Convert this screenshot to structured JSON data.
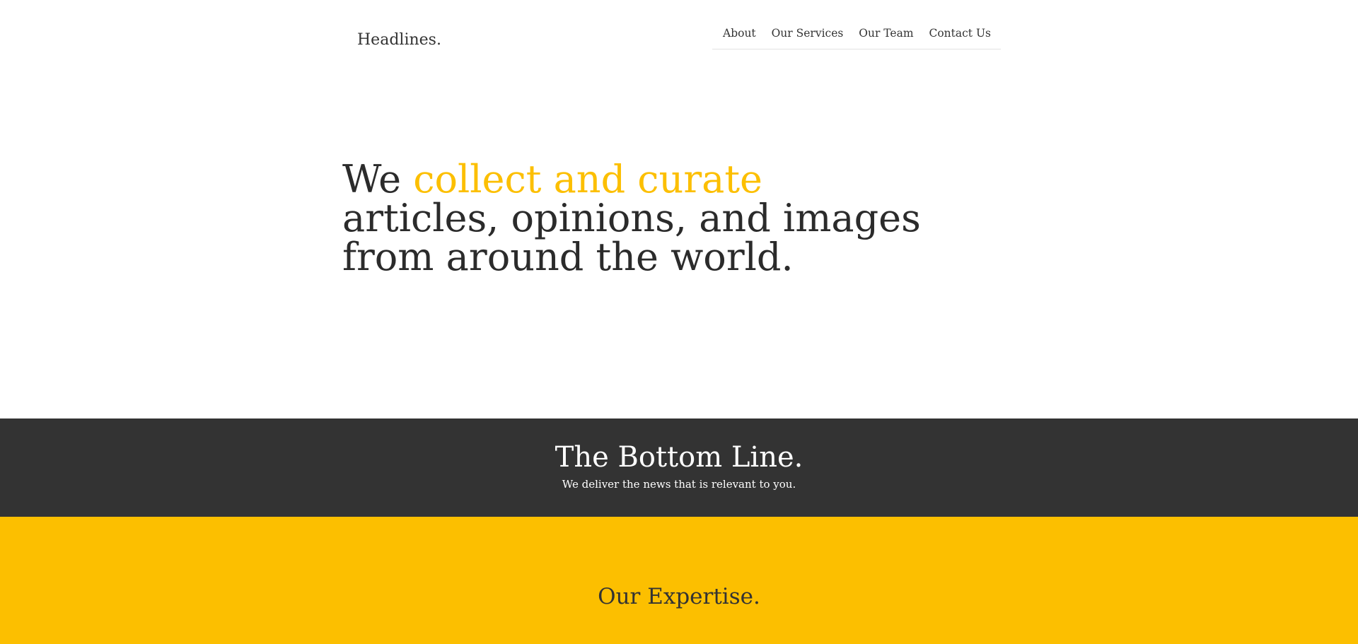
{
  "header": {
    "brand": "Headlines.",
    "nav": [
      {
        "label": "About"
      },
      {
        "label": "Our Services"
      },
      {
        "label": "Our Team"
      },
      {
        "label": "Contact Us"
      }
    ]
  },
  "hero": {
    "lead": "We",
    "highlight": "collect and curate",
    "line2": "articles, opinions, and images",
    "line3": "from around the world."
  },
  "bottom_line": {
    "title": "The Bottom Line.",
    "subtitle": "We deliver the news that is relevant to you."
  },
  "expertise": {
    "title": "Our Expertise."
  },
  "colors": {
    "accent": "#fcbf00",
    "dark_band": "#333333",
    "text": "#2b2b2b"
  }
}
